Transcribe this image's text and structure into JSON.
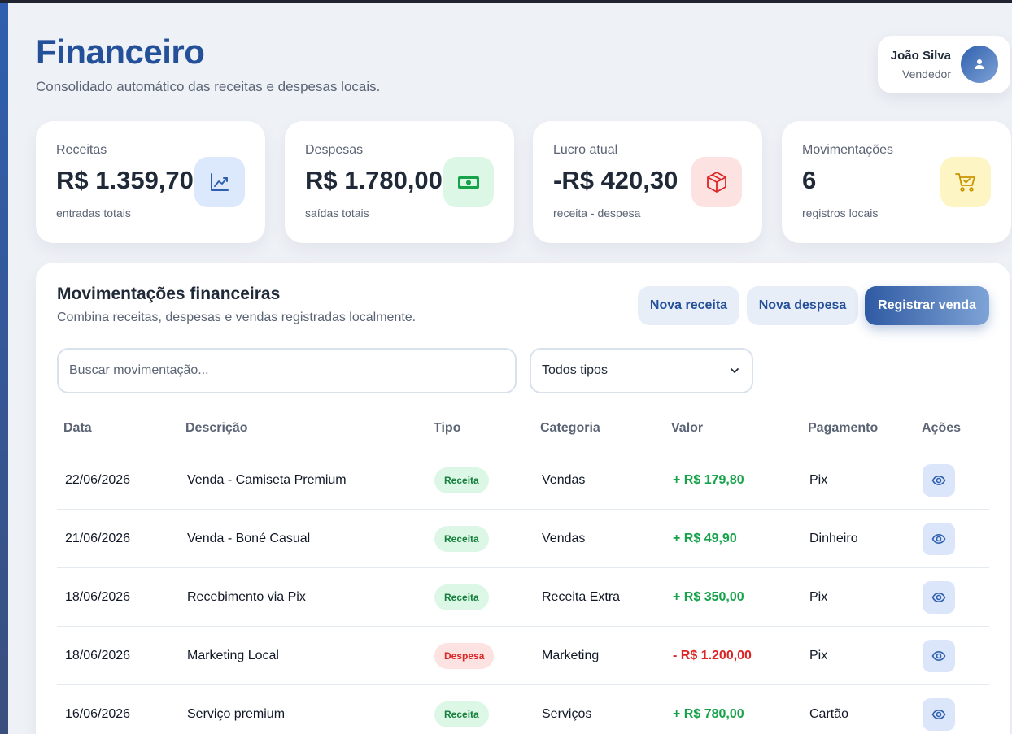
{
  "header": {
    "title": "Financeiro",
    "subtitle": "Consolidado automático das receitas e despesas locais."
  },
  "user": {
    "name": "João Silva",
    "role": "Vendedor",
    "avatar_icon": "user-icon"
  },
  "stats": [
    {
      "label": "Receitas",
      "value": "R$ 1.359,70",
      "note": "entradas totais",
      "icon": "trending-up-icon",
      "bg": "#dce8fb",
      "fg": "#2f5fae"
    },
    {
      "label": "Despesas",
      "value": "R$ 1.780,00",
      "note": "saídas totais",
      "icon": "cash-icon",
      "bg": "#dcf7e6",
      "fg": "#16a34a"
    },
    {
      "label": "Lucro atual",
      "value": "-R$ 420,30",
      "note": "receita - despesa",
      "icon": "box-icon",
      "bg": "#fde2e2",
      "fg": "#dc2626"
    },
    {
      "label": "Movimentações",
      "value": "6",
      "note": "registros locais",
      "icon": "cart-icon",
      "bg": "#fdf5c4",
      "fg": "#c99400"
    }
  ],
  "panel": {
    "title": "Movimentações financeiras",
    "subtitle": "Combina receitas, despesas e vendas registradas localmente.",
    "buttons": {
      "nova_receita": "Nova receita",
      "nova_despesa": "Nova despesa",
      "registrar_venda": "Registrar venda"
    },
    "search_placeholder": "Buscar movimentação...",
    "filter_value": "Todos tipos",
    "columns": [
      "Data",
      "Descrição",
      "Tipo",
      "Categoria",
      "Valor",
      "Pagamento",
      "Ações"
    ]
  },
  "rows": [
    {
      "data": "22/06/2026",
      "descricao": "Venda - Camiseta Premium",
      "tipo": "Receita",
      "categoria": "Vendas",
      "valor": "+ R$ 179,80",
      "pagamento": "Pix"
    },
    {
      "data": "21/06/2026",
      "descricao": "Venda - Boné Casual",
      "tipo": "Receita",
      "categoria": "Vendas",
      "valor": "+ R$ 49,90",
      "pagamento": "Dinheiro"
    },
    {
      "data": "18/06/2026",
      "descricao": "Recebimento via Pix",
      "tipo": "Receita",
      "categoria": "Receita Extra",
      "valor": "+ R$ 350,00",
      "pagamento": "Pix"
    },
    {
      "data": "18/06/2026",
      "descricao": "Marketing Local",
      "tipo": "Despesa",
      "categoria": "Marketing",
      "valor": "- R$ 1.200,00",
      "pagamento": "Pix"
    },
    {
      "data": "16/06/2026",
      "descricao": "Serviço premium",
      "tipo": "Receita",
      "categoria": "Serviços",
      "valor": "+ R$ 780,00",
      "pagamento": "Cartão"
    }
  ],
  "colors": {
    "receita_bg": "#dcf7e6",
    "receita_fg": "#15803d",
    "despesa_bg": "#fde2e2",
    "despesa_fg": "#dc2626",
    "positive": "#16a34a",
    "negative": "#dc2626"
  }
}
